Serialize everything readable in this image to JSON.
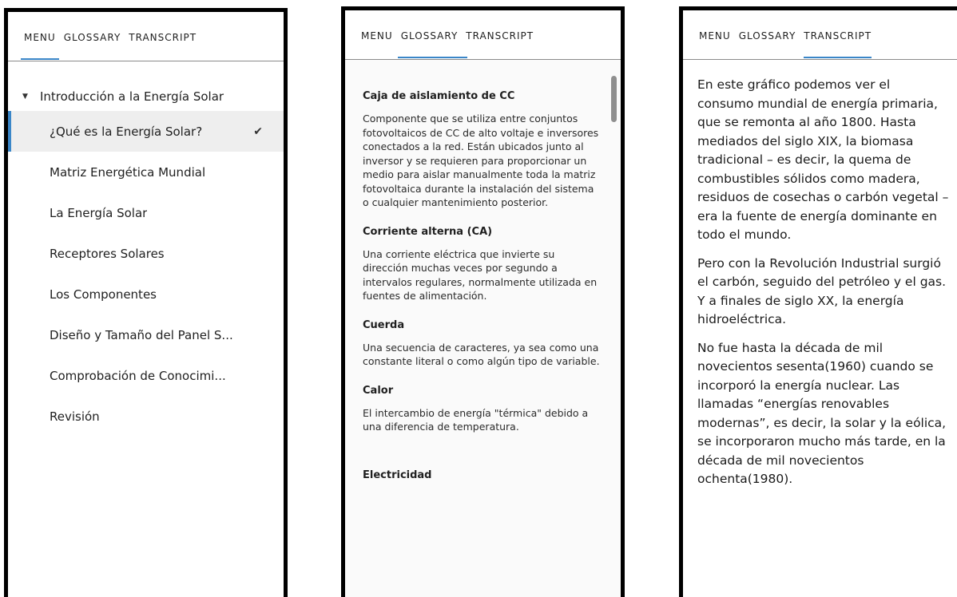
{
  "tabs": {
    "menu": "MENU",
    "glossary": "GLOSSARY",
    "transcript": "TRANSCRIPT"
  },
  "menu": {
    "section_title": "Introducción a la Energía Solar",
    "items": [
      {
        "label": "¿Qué es la Energía Solar?",
        "active": true,
        "completed": true
      },
      {
        "label": "Matriz Energética Mundial"
      },
      {
        "label": "La Energía Solar"
      },
      {
        "label": "Receptores Solares"
      },
      {
        "label": "Los Componentes"
      },
      {
        "label": "Diseño y Tamaño del Panel S..."
      },
      {
        "label": "Comprobación de Conocimi..."
      },
      {
        "label": "Revisión"
      }
    ]
  },
  "glossary": {
    "entries": [
      {
        "term": "Caja de aislamiento de CC",
        "definition": "Componente que se utiliza entre conjuntos fotovoltaicos de CC de alto voltaje e inversores conectados a la red. Están ubicados junto al inversor y se requieren para proporcionar un medio para aislar manualmente toda la matriz fotovoltaica durante la instalación del sistema o cualquier mantenimiento posterior."
      },
      {
        "term": "Corriente alterna (CA)",
        "definition": "Una corriente eléctrica que invierte su dirección muchas veces por segundo a intervalos regulares, normalmente utilizada en fuentes de alimentación."
      },
      {
        "term": "Cuerda",
        "definition": "Una secuencia de caracteres, ya sea como una constante literal o como algún tipo de variable."
      },
      {
        "term": "Calor",
        "definition": "El intercambio de energía \"térmica\" debido a una diferencia de temperatura."
      },
      {
        "term": "Electricidad",
        "definition": ""
      }
    ]
  },
  "transcript": {
    "paragraphs": [
      "En este gráfico podemos ver el consumo mundial de energía primaria, que se remonta al año 1800. Hasta mediados del siglo XIX, la biomasa tradicional – es decir, la quema de combustibles sólidos como madera, residuos de cosechas o carbón vegetal – era la fuente de energía dominante en todo el mundo.",
      "Pero con la Revolución Industrial surgió el carbón, seguido del petróleo y el gas. Y a finales de siglo XX, la energía hidroeléctrica.",
      "No fue hasta la década de mil novecientos sesenta(1960) cuando se incorporó la energía nuclear. Las llamadas “energías renovables modernas”, es decir, la solar y la eólica, se incorporaron mucho más tarde, en la década de mil novecientos ochenta(1980)."
    ]
  },
  "colors": {
    "accent": "#3a86c8",
    "active_bg": "#eeeeee",
    "frame": "#000000"
  },
  "icons": {
    "section_caret": "caret-down-icon",
    "completed": "checkmark-icon"
  }
}
